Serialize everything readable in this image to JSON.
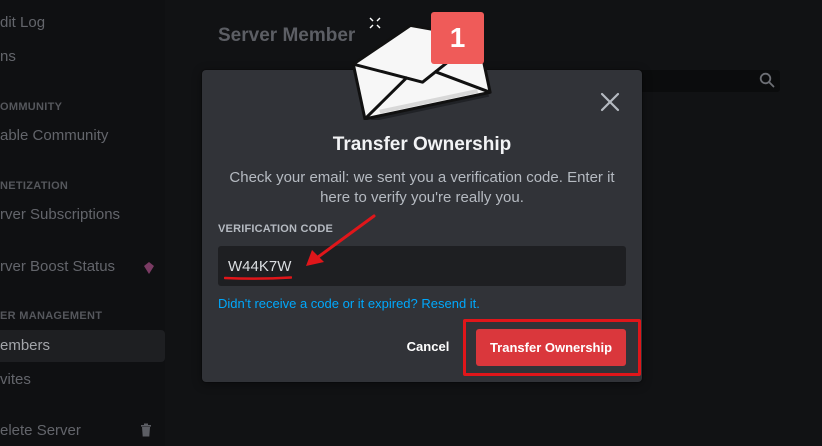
{
  "sidebar": {
    "items": [
      {
        "label": "dit Log"
      },
      {
        "label": "ns"
      },
      {
        "label": "able Community"
      },
      {
        "label": "rver Subscriptions"
      },
      {
        "label": "rver Boost Status"
      },
      {
        "label": "embers"
      },
      {
        "label": "vites"
      },
      {
        "label": "elete Server"
      }
    ],
    "headers": [
      "OMMUNITY",
      "NETIZATION",
      "ER MANAGEMENT"
    ]
  },
  "main": {
    "title": "Server Member"
  },
  "modal": {
    "step_badge": "1",
    "title": "Transfer Ownership",
    "description": "Check your email: we sent you a verification code. Enter it here to verify you're really you.",
    "field_label": "VERIFICATION CODE",
    "code_value": "W44K7W",
    "resend_link": "Didn't receive a code or it expired? Resend it.",
    "cancel_label": "Cancel",
    "confirm_label": "Transfer Ownership"
  },
  "colors": {
    "accent_red": "#da373c",
    "link_blue": "#00a8fc",
    "annotation_red": "#e0161a",
    "badge_red": "#ef5b59"
  },
  "icons": [
    "envelope-icon",
    "close-icon",
    "search-icon",
    "boost-gem-icon",
    "trash-icon",
    "sparkle-icon"
  ]
}
